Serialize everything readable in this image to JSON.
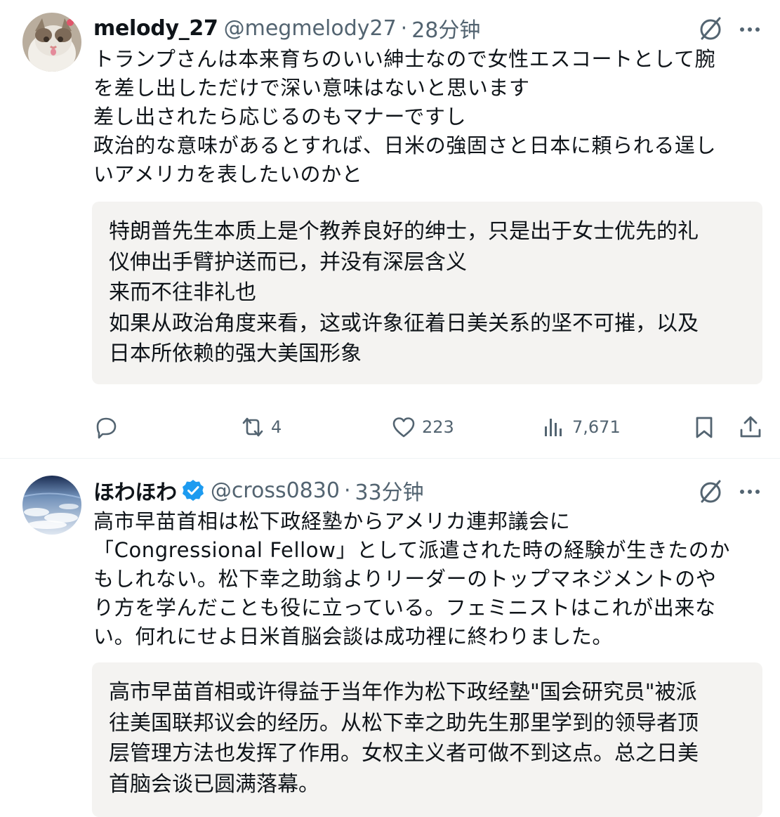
{
  "tweets": [
    {
      "display_name": "melody_27",
      "handle": "@megmelody27",
      "time": "28分钟",
      "text": "トランプさんは本来育ちのいい紳士なので女性エスコートとして腕\nを差し出しただけで深い意味はないと思います\n差し出されたら応じるのもマナーですし\n政治的な意味があるとすれば、日米の強固さと日本に頼られる逞し\nいアメリカを表したいのかと",
      "translation": "特朗普先生本质上是个教养良好的绅士，只是出于女士优先的礼\n仪伸出手臂护送而已，并没有深层含义\n来而不往非礼也\n如果从政治角度来看，这或许象征着日美关系的坚不可摧，以及\n日本所依赖的强大美国形象",
      "stats": {
        "replies": "",
        "reposts": "4",
        "likes": "223",
        "views": "7,671"
      },
      "icons": [
        "grok-icon",
        "more-icon",
        "reply-icon",
        "repost-icon",
        "like-icon",
        "views-icon",
        "bookmark-icon",
        "share-icon"
      ]
    },
    {
      "display_name": "ほわほわ",
      "handle": "@cross0830",
      "time": "33分钟",
      "verified": true,
      "text": "高市早苗首相は松下政経塾からアメリカ連邦議会に\n「Congressional Fellow」として派遣された時の経験が生きたのか\nもしれない。松下幸之助翁よりリーダーのトップマネジメントのや\nり方を学んだことも役に立っている。フェミニストはこれが出来な\nい。何れにせよ日米首脳会談は成功裡に終わりました。",
      "translation": "高市早苗首相或许得益于当年作为松下政经塾\"国会研究员\"被派\n往美国联邦议会的经历。从松下幸之助先生那里学到的领导者顶\n层管理方法也发挥了作用。女权主义者可做不到这点。总之日美\n首脑会谈已圆满落幕。",
      "icons": [
        "grok-icon",
        "more-icon",
        "verified-badge-icon"
      ]
    }
  ],
  "colors": {
    "secondary_text": "#536471",
    "verified_blue": "#1d9bf0",
    "translation_bg": "#f4f3f1"
  },
  "separator": "·"
}
